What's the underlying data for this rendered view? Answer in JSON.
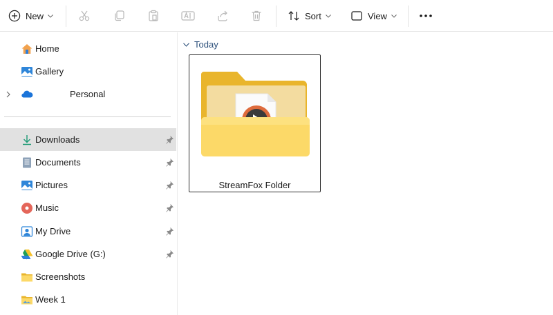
{
  "toolbar": {
    "new_label": "New",
    "sort_label": "Sort",
    "view_label": "View",
    "actions": [
      "cut-icon",
      "copy-icon",
      "paste-icon",
      "rename-icon",
      "share-icon",
      "delete-icon"
    ]
  },
  "sidebar": {
    "quick": [
      {
        "label": "Home",
        "icon": "home-icon"
      },
      {
        "label": "Gallery",
        "icon": "gallery-icon"
      },
      {
        "label": "Personal",
        "icon": "onedrive-cloud-icon"
      }
    ],
    "pinned": [
      {
        "label": "Downloads",
        "icon": "download-icon",
        "pinned": true,
        "selected": true
      },
      {
        "label": "Documents",
        "icon": "documents-icon",
        "pinned": true
      },
      {
        "label": "Pictures",
        "icon": "pictures-icon",
        "pinned": true
      },
      {
        "label": "Music",
        "icon": "music-icon",
        "pinned": true
      },
      {
        "label": "My Drive",
        "icon": "my-drive-icon",
        "pinned": true
      },
      {
        "label": "Google Drive (G:)",
        "icon": "google-drive-icon",
        "pinned": true
      },
      {
        "label": "Screenshots",
        "icon": "folder-icon",
        "pinned": false
      },
      {
        "label": "Week 1",
        "icon": "folder-image-icon",
        "pinned": false
      }
    ]
  },
  "main": {
    "group_label": "Today",
    "items": [
      {
        "name": "StreamFox Folder",
        "icon": "folder-media-icon",
        "selected": true
      }
    ]
  },
  "colors": {
    "folder_back": "#e9b52c",
    "folder_front": "#fcd968",
    "selection": "#e1e1e1",
    "accent": "#0067c0"
  }
}
